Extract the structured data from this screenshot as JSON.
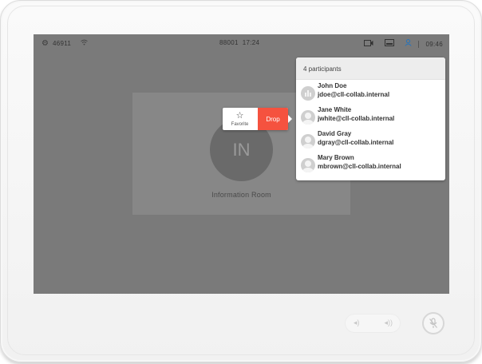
{
  "status_bar": {
    "left_number": "46911",
    "center_number": "88001",
    "center_time": "17:24",
    "right_time": "09:46"
  },
  "call": {
    "avatar_initials": "IN",
    "room_name": "Information Room"
  },
  "participants": {
    "header": "4 participants",
    "items": [
      {
        "name": "John Doe",
        "email": "jdoe@cll-collab.internal",
        "avatar": "group"
      },
      {
        "name": "Jane White",
        "email": "jwhite@cll-collab.internal",
        "avatar": "person"
      },
      {
        "name": "David Gray",
        "email": "dgray@cll-collab.internal",
        "avatar": "person"
      },
      {
        "name": "Mary Brown",
        "email": "mbrown@cll-collab.internal",
        "avatar": "person"
      }
    ]
  },
  "popup": {
    "favorite_label": "Favorite",
    "drop_label": "Drop"
  },
  "icons": {
    "settings": "gear-icon",
    "wifi": "wifi-icon",
    "camera": "camera-icon",
    "screen": "screen-icon",
    "participants": "person-icon",
    "star": "star-icon",
    "volume_down": "volume-down-icon",
    "volume_up": "volume-up-icon",
    "mute": "mic-mute-icon"
  },
  "colors": {
    "drop": "#f5523f",
    "screen_bg": "#7a7a7a",
    "accent_icon": "#2a74b8"
  }
}
